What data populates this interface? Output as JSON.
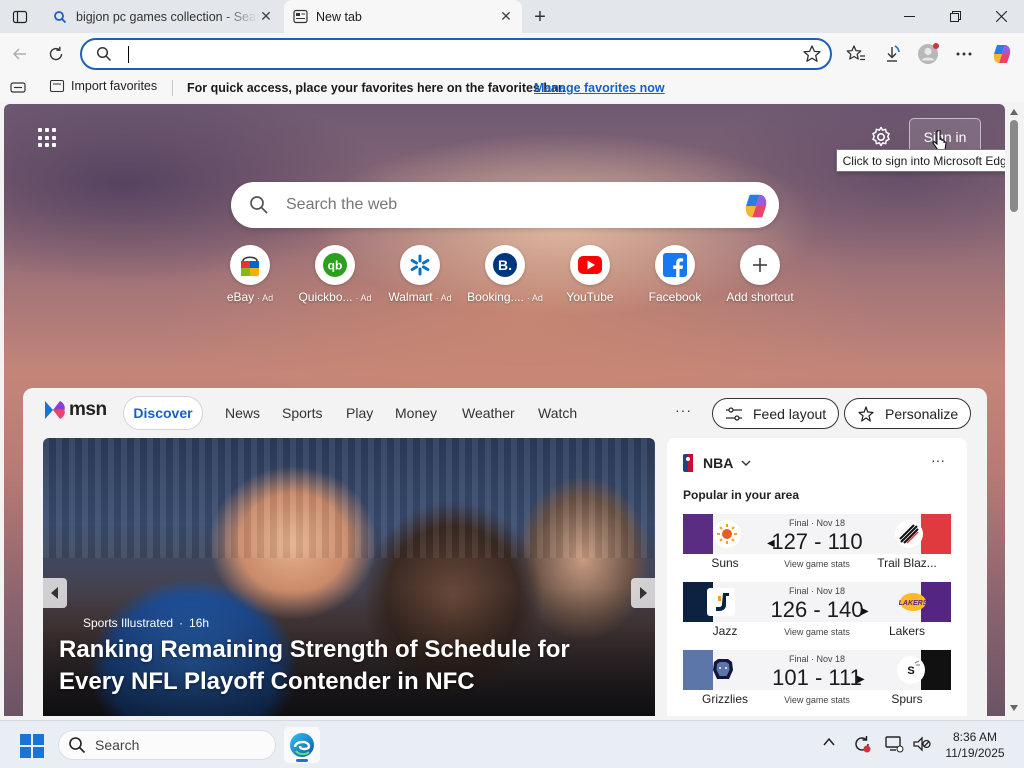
{
  "tabs": [
    {
      "title": "bigjon pc games collection - Search",
      "active": false
    },
    {
      "title": "New tab",
      "active": true
    }
  ],
  "toolbar": {
    "address_value": "",
    "address_placeholder": ""
  },
  "favorites_bar": {
    "import_label": "Import favorites",
    "message": "For quick access, place your favorites here on the favorites bar.",
    "manage_link": "Manage favorites now"
  },
  "ntp": {
    "signin_label": "Sign in",
    "tooltip": "Click to sign into Microsoft Edge",
    "search_placeholder": "Search the web",
    "shortcuts": [
      {
        "label": "eBay",
        "ad": "· Ad",
        "icon": "ebay-icon"
      },
      {
        "label": "Quickbo...",
        "ad": "· Ad",
        "icon": "quickbooks-icon"
      },
      {
        "label": "Walmart",
        "ad": "· Ad",
        "icon": "walmart-icon"
      },
      {
        "label": "Booking....",
        "ad": "· Ad",
        "icon": "booking-icon"
      },
      {
        "label": "YouTube",
        "ad": "",
        "icon": "youtube-icon"
      },
      {
        "label": "Facebook",
        "ad": "",
        "icon": "facebook-icon"
      },
      {
        "label": "Add shortcut",
        "ad": "",
        "icon": "plus-icon"
      }
    ]
  },
  "feed": {
    "logo_text": "msn",
    "nav": [
      "Discover",
      "News",
      "Sports",
      "Play",
      "Money",
      "Weather",
      "Watch"
    ],
    "more": "···",
    "feed_layout_label": "Feed layout",
    "personalize_label": "Personalize",
    "hero": {
      "source": "Sports Illustrated",
      "age": "16h",
      "headline": "Ranking Remaining Strength of Schedule for Every NFL Playoff Contender in NFC"
    },
    "nba": {
      "title": "NBA",
      "subtitle": "Popular in your area",
      "more": "···",
      "games": [
        {
          "status": "Final · Nov 18",
          "score": "127 - 110",
          "home": "Suns",
          "away": "Trail Blaz...",
          "stats": "View game stats",
          "winner": "left",
          "home_color": "#5a2d82",
          "away_color": "#e03a3e"
        },
        {
          "status": "Final · Nov 18",
          "score": "126 - 140",
          "home": "Jazz",
          "away": "Lakers",
          "stats": "View game stats",
          "winner": "right",
          "home_color": "#0b2240",
          "away_color": "#552583"
        },
        {
          "status": "Final · Nov 18",
          "score": "101 - 111",
          "home": "Grizzlies",
          "away": "Spurs",
          "stats": "View game stats",
          "winner": "right",
          "home_color": "#5d76a9",
          "away_color": "#111111"
        }
      ]
    }
  },
  "taskbar": {
    "search_label": "Search",
    "time": "8:36 AM",
    "date": "11/19/2025"
  }
}
